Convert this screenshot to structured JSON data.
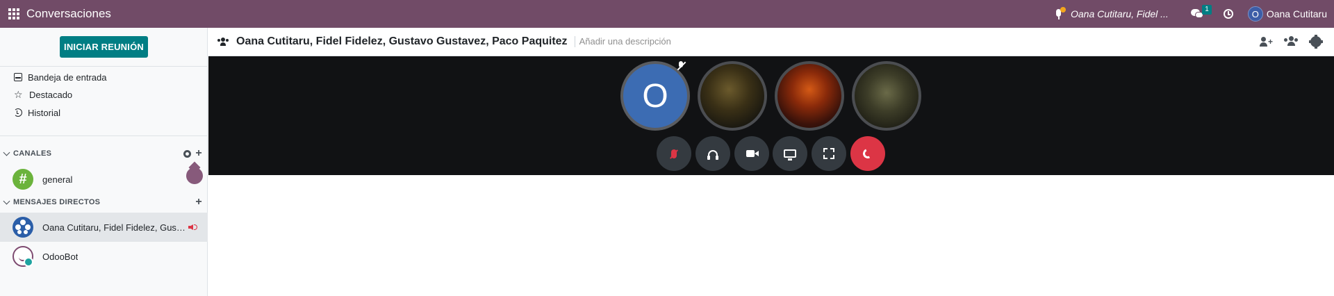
{
  "navbar": {
    "app_title": "Conversaciones",
    "call_label": "Oana Cutitaru, Fidel ...",
    "chat_badge": "1",
    "user_initial": "O",
    "user_name": "Oana Cutitaru",
    "colors": {
      "bar": "#714b67",
      "badge": "#017e84",
      "call_dot": "#f3a51c"
    }
  },
  "sidebar": {
    "start_meeting_label": "INICIAR REUNIÓN",
    "mailboxes": [
      {
        "label": "Bandeja de entrada",
        "icon": "inbox-icon"
      },
      {
        "label": "Destacado",
        "icon": "star-icon"
      },
      {
        "label": "Historial",
        "icon": "history-icon"
      }
    ],
    "channels_header": "CANALES",
    "channels": [
      {
        "name": "general",
        "avatar": "#"
      }
    ],
    "direct_header": "MENSAJES DIRECTOS",
    "direct_messages": [
      {
        "name": "Oana Cutitaru, Fidel Fidelez, Gustavo Gustavez, Paco Paquitez",
        "active": true,
        "in_call": true
      },
      {
        "name": "OdooBot",
        "active": false,
        "in_call": false
      }
    ]
  },
  "thread": {
    "title": "Oana Cutitaru, Fidel Fidelez, Gustavo Gustavez, Paco Paquitez",
    "description_placeholder": "Añadir una descripción"
  },
  "call": {
    "self_initial": "O",
    "participants": [
      "Oana Cutitaru",
      "Fidel Fidelez",
      "Gustavo Gustavez",
      "Paco Paquitez"
    ],
    "controls": [
      "unmute",
      "deafen",
      "camera",
      "screen-share",
      "fullscreen",
      "hang-up"
    ],
    "colors": {
      "background": "#111214",
      "hangup": "#dc3545",
      "self_avatar": "#3c6cb3"
    }
  }
}
